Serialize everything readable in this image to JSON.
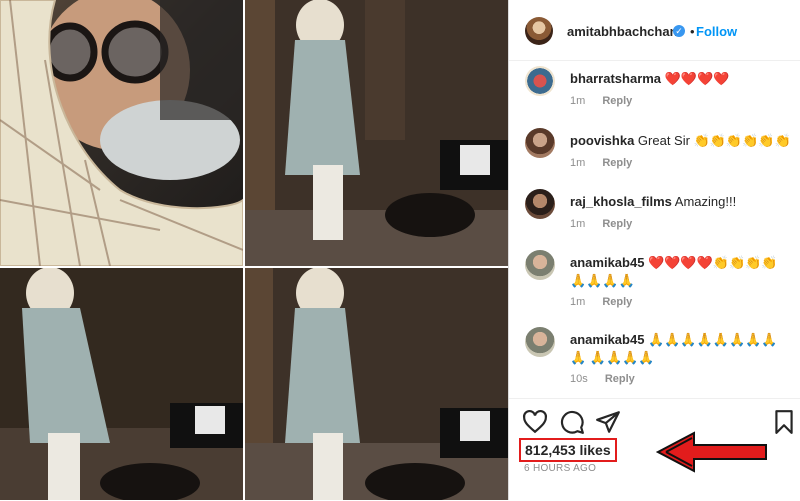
{
  "post": {
    "username": "amitabhbachchan",
    "verified_mark": "✓",
    "dot": "•",
    "follow_label": "Follow"
  },
  "comments": [
    {
      "user": "bharratsharma",
      "text": "❤️❤️❤️❤️",
      "time": "1m",
      "reply": "Reply"
    },
    {
      "user": "poovishka",
      "text": "Great Sir 👏👏👏👏👏👏",
      "time": "1m",
      "reply": "Reply"
    },
    {
      "user": "raj_khosla_films",
      "text": "Amazing!!!",
      "time": "1m",
      "reply": "Reply"
    },
    {
      "user": "anamikab45",
      "text": "❤️❤️❤️❤️👏👏👏👏 🙏🙏🙏🙏",
      "time": "1m",
      "reply": "Reply"
    },
    {
      "user": "anamikab45",
      "text": "🙏🙏🙏🙏🙏🙏🙏🙏🙏 🙏🙏🙏🙏",
      "time": "10s",
      "reply": "Reply"
    }
  ],
  "likes": "812,453 likes",
  "time_ago": "6 HOURS AGO",
  "icons": [
    "heart-icon",
    "comment-icon",
    "share-icon",
    "bookmark-icon"
  ],
  "colors": {
    "follow": "#0095f6",
    "highlight": "#e21c1c",
    "verified": "#3897f0"
  }
}
